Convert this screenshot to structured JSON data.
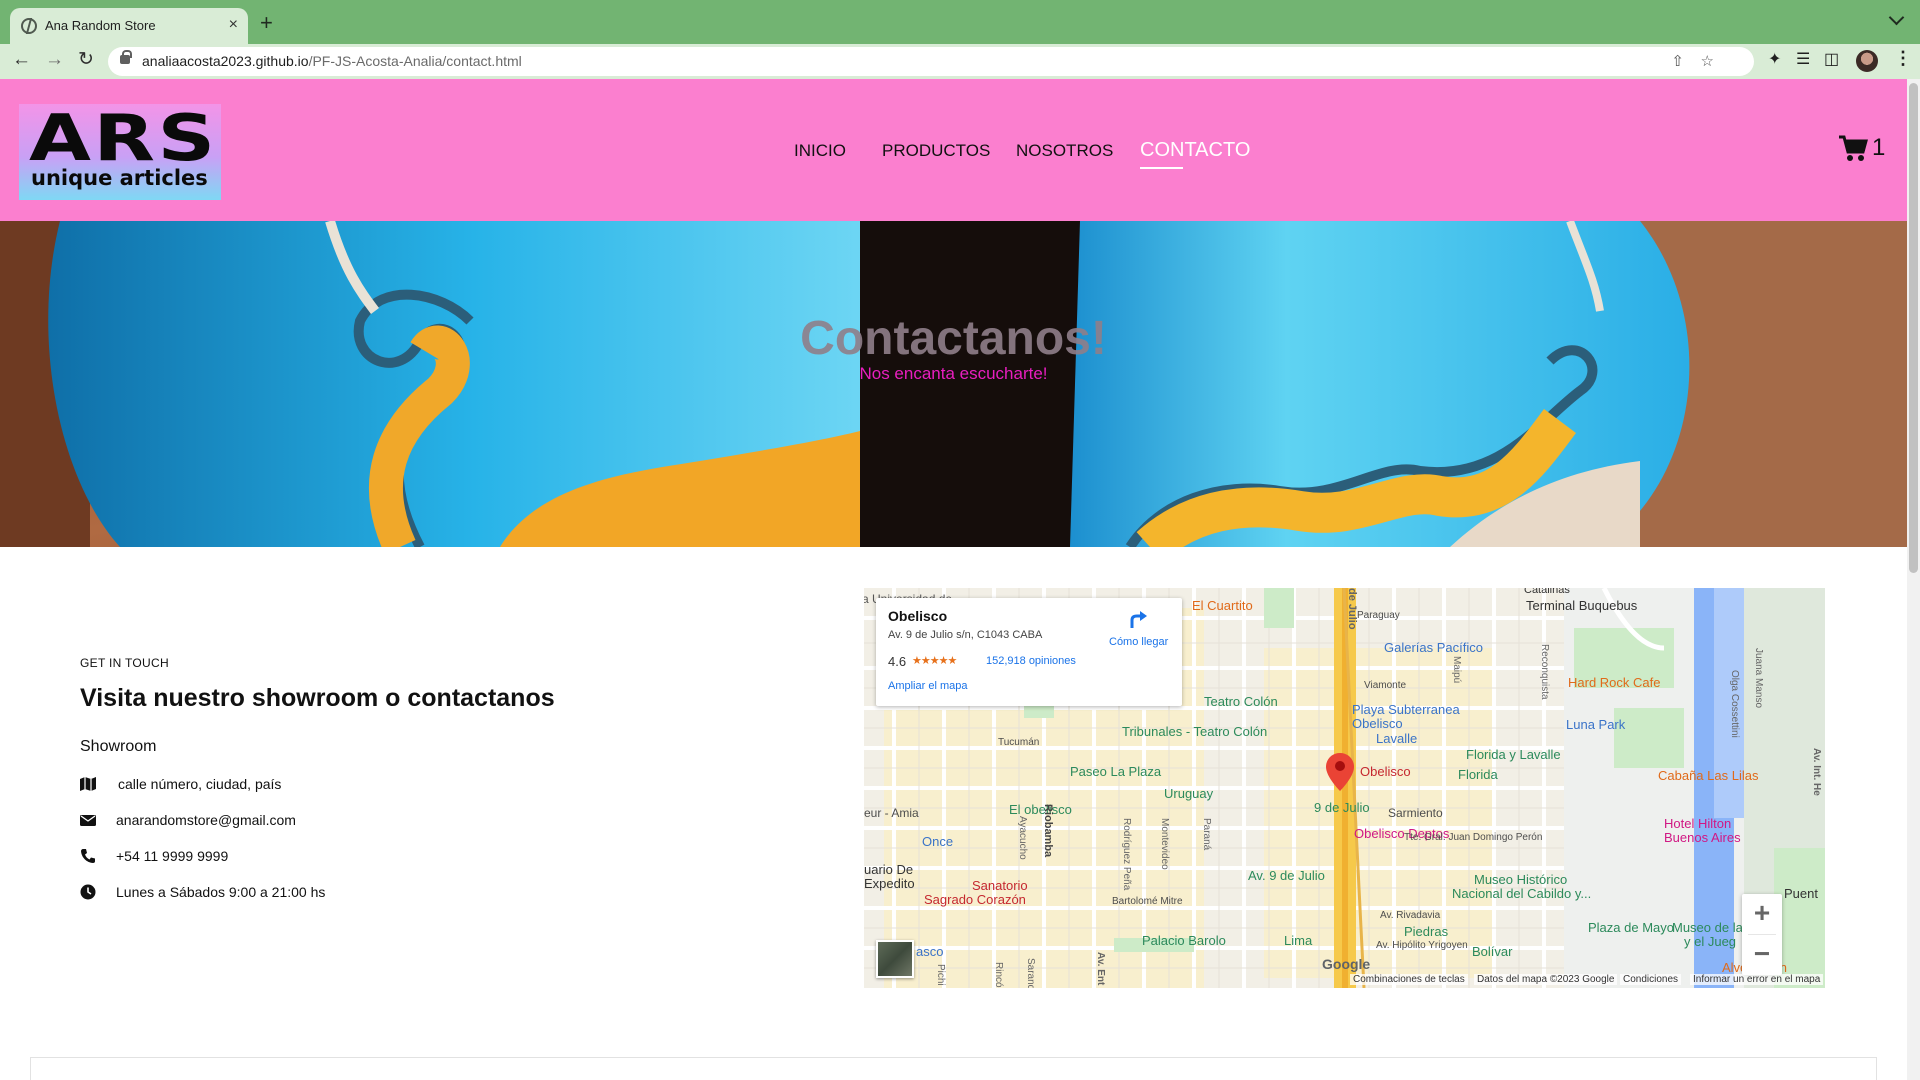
{
  "browser": {
    "tab_title": "Ana Random Store",
    "tab_close": "×",
    "new_tab": "+",
    "url_host": "analiaacosta2023.github.io",
    "url_path": "/PF-JS-Acosta-Analia/contact.html"
  },
  "header": {
    "logo_big": "ARS",
    "logo_small": "unique articles",
    "nav": {
      "inicio": "INICIO",
      "productos": "PRODUCTOS",
      "nosotros": "NOSOTROS",
      "contacto": "CONTACTO"
    },
    "cart_count": "1",
    "background_color": "#fb7fcf"
  },
  "hero": {
    "title": "Contactanos!",
    "subtitle": "Nos encanta escucharte!"
  },
  "contact": {
    "eyebrow": "GET IN TOUCH",
    "heading": "Visita nuestro showroom o contactanos",
    "showroom_label": "Showroom",
    "address": "calle número, ciudad, país",
    "email": "anarandomstore@gmail.com",
    "phone": "+54 11 9999 9999",
    "hours": "Lunes a Sábados 9:00 a 21:00 hs",
    "icons": [
      "map-icon",
      "envelope-icon",
      "phone-icon",
      "clock-icon"
    ]
  },
  "map": {
    "place_name": "Obelisco",
    "place_address": "Av. 9 de Julio s/n, C1043 CABA",
    "rating": "4.6",
    "stars": "★★★★★",
    "reviews": "152,918 opiniones",
    "expand": "Ampliar el mapa",
    "directions": "Cómo llegar",
    "labels": {
      "la_universidad": "a Universidad de",
      "cuartito": "El Cuartito",
      "de_julio": "de Julio",
      "paraguay": "Paraguay",
      "catalinas": "Catalinas",
      "terminal": "Terminal Buquebus",
      "galerias": "Galerías Pacífico",
      "viamonte": "Viamonte",
      "hard_rock": "Hard Rock Cafe",
      "teatro_colon": "Teatro Colón",
      "playa": "Playa Subterranea",
      "obelisco_playa": "Obelisco",
      "lavalle": "Lavalle",
      "luna_park": "Luna Park",
      "tucuman": "Tucumán",
      "tribunales": "Tribunales - Teatro Colón",
      "florida_lavalle": "Florida y Lavalle",
      "florida": "Florida",
      "paseo": "Paseo La Plaza",
      "uruguay": "Uruguay",
      "obelisco": "Obelisco",
      "cabana": "Cabaña Las Lilas",
      "amia": "eur - Amia",
      "el_obelisco": "El obelisco",
      "nueve_julio": "9 de Julio",
      "sarmiento": "Sarmiento",
      "once": "Once",
      "obelisco_deptos": "Obelisco Deptos",
      "peron": "Tte. Gral. Juan Domingo Perón",
      "hilton": "Hotel Hilton",
      "hilton2": "Buenos Aires",
      "expedito": "uario De",
      "expedito2": "Expedito",
      "sanatorio": "Sanatorio",
      "sagrado": "Sagrado Corazón",
      "av9": "Av. 9 de Julio",
      "museo": "Museo Histórico",
      "museo2": "Nacional del Cabildo y...",
      "bartolome": "Bartolomé Mitre",
      "rivadavia": "Av. Rivadavia",
      "piedras": "Piedras",
      "plaza_mayo": "Plaza de Mayo",
      "museo_ima": "Museo de la Ima",
      "museo_ima2": "y el Jueg",
      "puent": "Puent",
      "palacio": "Palacio Barolo",
      "lima": "Lima",
      "yrigoyen": "Av. Hipólito Yrigoyen",
      "bolivar": "Bolívar",
      "alvear": "Alvear Icon",
      "asco": "asco",
      "riobamba": "Riobamba",
      "ayacucho": "Ayacucho",
      "montevideo": "Montevideo",
      "rodriguez": "Rodríguez Peña",
      "parana": "Paraná",
      "reconquista": "Reconquista",
      "maipu": "Maipú",
      "olga": "Olga Cossettini",
      "juana": "Juana Manso",
      "pichi": "Pichi",
      "rincon": "Rincón",
      "sarand": "Sarand",
      "av_ent": "Av. Ent",
      "av_int": "Av. Int. He",
      "av_9_top": "9 de Julio"
    },
    "google": "Google",
    "footer": {
      "shortcuts": "Combinaciones de teclas",
      "data": "Datos del mapa ©2023 Google",
      "terms": "Condiciones",
      "report": "Informar un error en el mapa"
    },
    "zoom_in": "+",
    "zoom_out": "−"
  }
}
